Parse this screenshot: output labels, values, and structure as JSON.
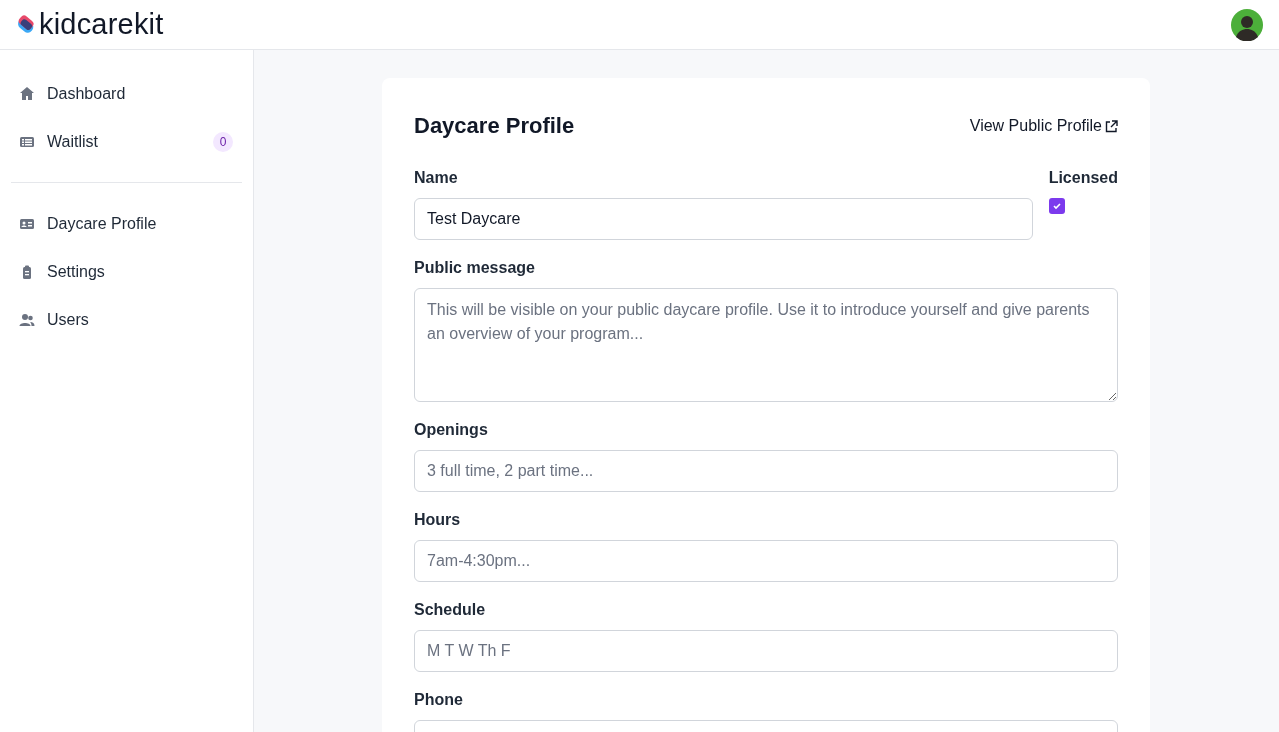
{
  "header": {
    "logo_text": "kidcarekit"
  },
  "sidebar": {
    "groups": [
      [
        {
          "label": "Dashboard"
        },
        {
          "label": "Waitlist",
          "badge": "0"
        }
      ],
      [
        {
          "label": "Daycare Profile"
        },
        {
          "label": "Settings"
        },
        {
          "label": "Users"
        }
      ]
    ]
  },
  "profile": {
    "title": "Daycare Profile",
    "link": "View Public Profile",
    "licensed": {
      "label": "Licensed",
      "checked": true
    },
    "fields": [
      {
        "kind": "text",
        "label": "Name",
        "value": "Test Daycare"
      },
      {
        "kind": "textarea",
        "label": "Public message",
        "placeholder": "This will be visible on your public daycare profile. Use it to introduce yourself and give parents an overview of your program..."
      },
      {
        "kind": "text",
        "label": "Openings",
        "placeholder": "3 full time, 2 part time..."
      },
      {
        "kind": "text",
        "label": "Hours",
        "placeholder": "7am-4:30pm..."
      },
      {
        "kind": "text",
        "label": "Schedule",
        "placeholder": "M T W Th F"
      },
      {
        "kind": "text",
        "label": "Phone"
      }
    ]
  }
}
